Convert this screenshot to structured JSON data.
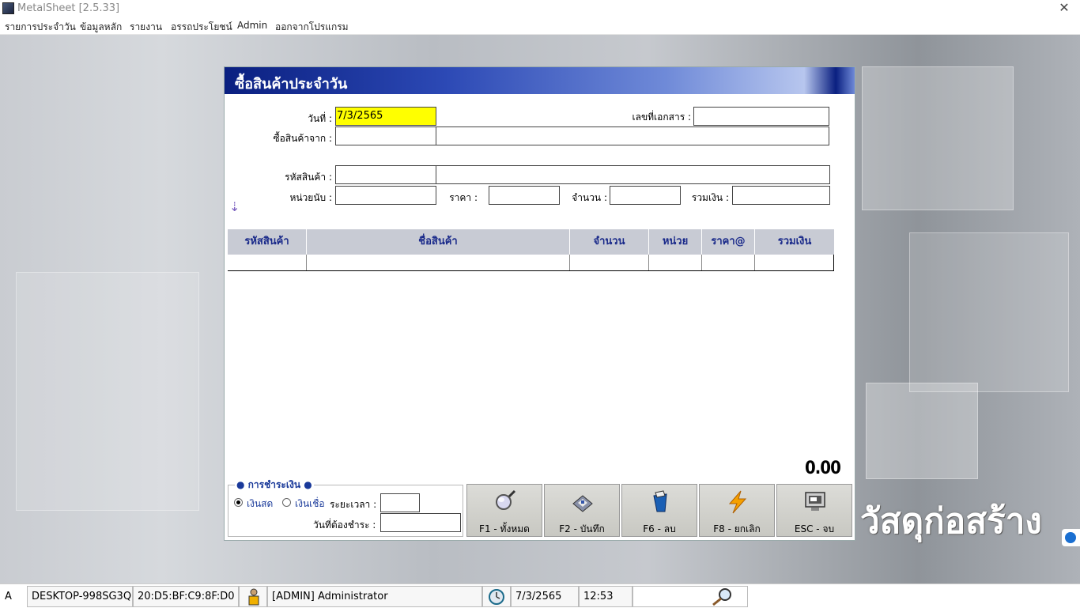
{
  "window": {
    "title": "MetalSheet [2.5.33]",
    "close": "✕"
  },
  "menu": [
    "รายการประจำวัน",
    "ข้อมูลหลัก",
    "รายงาน",
    "อรรถประโยชน์",
    "Admin",
    "ออกจากโปรแกรม"
  ],
  "brand": {
    "text": "วัสดุก่อสร้าง"
  },
  "dialog": {
    "title": "ซื้อสินค้าประจำวัน",
    "labels": {
      "date": "วันที่ :",
      "doc_no": "เลขที่เอกสาร :",
      "supplier": "ซื้อสินค้าจาก :",
      "product_code": "รหัสสินค้า :",
      "unit": "หน่วยนับ :",
      "price": "ราคา :",
      "qty": "จำนวน :",
      "total": "รวมเงิน :"
    },
    "values": {
      "date": "7/3/2565",
      "doc_no": "",
      "supplier_code": "",
      "supplier_name": "",
      "product_code": "",
      "product_name": "",
      "unit": "",
      "price": "",
      "qty": "",
      "total": ""
    },
    "grid_columns": [
      "รหัสสินค้า",
      "ชื่อสินค้า",
      "จำนวน",
      "หน่วย",
      "ราคา@",
      "รวมเงิน"
    ],
    "grand_total": "0.00",
    "payment": {
      "legend": "● การชำระเงิน ●",
      "cash": "เงินสด",
      "credit": "เงินเชื่อ",
      "period": "ระยะเวลา :",
      "due_date": "วันที่ต้องชำระ :",
      "selected": "cash"
    },
    "buttons": [
      {
        "key": "f1",
        "label": "F1 - ทั้งหมด",
        "icon": "magnifier-icon"
      },
      {
        "key": "f2",
        "label": "F2 - บันทึก",
        "icon": "floppy-disk-icon"
      },
      {
        "key": "f6",
        "label": "F6 - ลบ",
        "icon": "trash-bin-icon"
      },
      {
        "key": "f8",
        "label": "F8 - ยกเลิก",
        "icon": "lightning-icon"
      },
      {
        "key": "esc",
        "label": "ESC - จบ",
        "icon": "monitor-icon"
      }
    ]
  },
  "status": {
    "mode": "A",
    "computer": "DESKTOP-998SG3Q",
    "mac": "20:D5:BF:C9:8F:D0",
    "user": "[ADMIN] Administrator",
    "date": "7/3/2565",
    "time": "12:53"
  },
  "colors": {
    "date_field_bg": "#ffff00",
    "header_dark": "#0a1f80",
    "grid_header_text": "#1a2a8a"
  }
}
